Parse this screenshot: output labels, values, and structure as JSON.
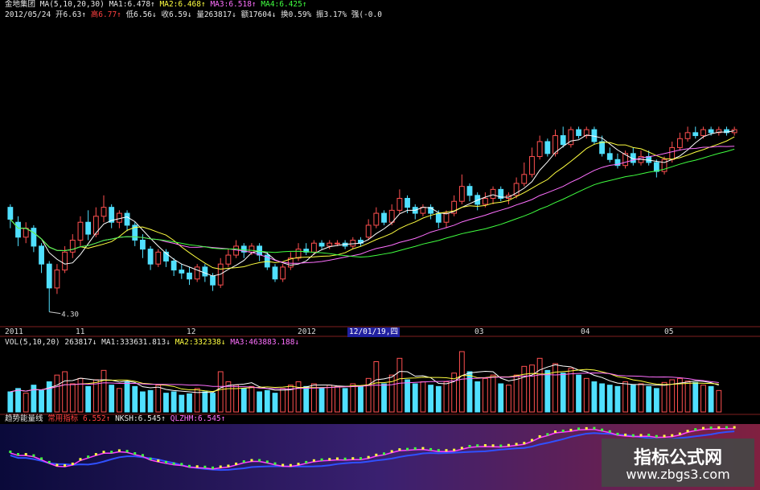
{
  "header": {
    "stock_name": "金地集团",
    "ma_params": "MA(5,10,20,30)",
    "ma1": "MA1:6.478↑",
    "ma2": "MA2:6.468↑",
    "ma3": "MA3:6.518↑",
    "ma4": "MA4:6.425↑",
    "date": "2012/05/24",
    "open": "开6.63↑",
    "high": "高6.77↑",
    "low": "低6.56↓",
    "close": "收6.59↓",
    "volume": "量263817↓",
    "amount": "额17604↓",
    "turnover": "换0.59%",
    "amplitude": "振3.17%",
    "strength": "强(-0.0"
  },
  "vol_header": {
    "params": "VOL(5,10,20)",
    "vol": "263817↓",
    "ma1": "MA1:333631.813↓",
    "ma2": "MA2:332338↓",
    "ma3": "MA3:463883.188↓"
  },
  "ind_header": {
    "name": "趋势能量线",
    "label": "常用指标",
    "value": "6.552↑",
    "nksh": "NKSH:6.545↑",
    "qlzhm": "QLZHM:6.545↑"
  },
  "x_axis": {
    "labels": [
      "2011",
      "11",
      "12",
      "2012",
      "03",
      "04",
      "05"
    ],
    "cursor_date": "12/01/19,四"
  },
  "watermark": {
    "line1": "指标公式网",
    "line2": "www.zbgs3.com"
  },
  "colors": {
    "up": "#ff5050",
    "down": "#50e0ff",
    "ma5": "#ffffff",
    "ma10": "#ffff40",
    "ma20": "#ff70ff",
    "ma30": "#40ff40"
  },
  "chart_data": {
    "type": "candlestick",
    "low_annotation": "4.30",
    "price_range": [
      4.2,
      7.5
    ],
    "candles": [
      [
        6.05,
        5.85,
        6.1,
        5.7
      ],
      [
        5.8,
        5.55,
        5.9,
        5.4
      ],
      [
        5.55,
        5.7,
        5.8,
        5.45
      ],
      [
        5.7,
        5.4,
        5.75,
        5.3
      ],
      [
        5.4,
        5.1,
        5.45,
        4.95
      ],
      [
        5.1,
        4.7,
        5.15,
        4.3
      ],
      [
        4.7,
        5.0,
        5.1,
        4.6
      ],
      [
        5.0,
        5.3,
        5.4,
        4.95
      ],
      [
        5.3,
        5.5,
        5.6,
        5.2
      ],
      [
        5.5,
        5.8,
        5.9,
        5.4
      ],
      [
        5.8,
        5.6,
        6.0,
        5.5
      ],
      [
        5.6,
        5.9,
        6.05,
        5.55
      ],
      [
        5.9,
        6.05,
        6.25,
        5.8
      ],
      [
        6.05,
        5.8,
        6.1,
        5.7
      ],
      [
        5.8,
        5.95,
        6.0,
        5.7
      ],
      [
        5.95,
        5.75,
        6.0,
        5.65
      ],
      [
        5.75,
        5.5,
        5.8,
        5.4
      ],
      [
        5.5,
        5.35,
        5.6,
        5.2
      ],
      [
        5.35,
        5.1,
        5.4,
        5.0
      ],
      [
        5.1,
        5.3,
        5.35,
        5.05
      ],
      [
        5.3,
        5.15,
        5.35,
        5.05
      ],
      [
        5.15,
        5.0,
        5.2,
        4.9
      ],
      [
        5.0,
        4.95,
        5.1,
        4.85
      ],
      [
        4.95,
        4.85,
        5.05,
        4.75
      ],
      [
        4.85,
        5.05,
        5.1,
        4.8
      ],
      [
        5.05,
        4.9,
        5.1,
        4.8
      ],
      [
        4.9,
        4.75,
        4.95,
        4.65
      ],
      [
        4.75,
        5.1,
        5.2,
        4.7
      ],
      [
        5.1,
        5.25,
        5.35,
        5.05
      ],
      [
        5.25,
        5.4,
        5.5,
        5.2
      ],
      [
        5.4,
        5.3,
        5.45,
        5.2
      ],
      [
        5.3,
        5.4,
        5.45,
        5.25
      ],
      [
        5.4,
        5.25,
        5.45,
        5.15
      ],
      [
        5.25,
        5.05,
        5.3,
        5.0
      ],
      [
        5.05,
        4.85,
        5.1,
        4.8
      ],
      [
        4.85,
        5.05,
        5.1,
        4.8
      ],
      [
        5.05,
        5.2,
        5.3,
        5.0
      ],
      [
        5.2,
        5.35,
        5.45,
        5.15
      ],
      [
        5.35,
        5.3,
        5.45,
        5.25
      ],
      [
        5.3,
        5.45,
        5.5,
        5.25
      ],
      [
        5.45,
        5.4,
        5.5,
        5.35
      ],
      [
        5.4,
        5.45,
        5.5,
        5.35
      ],
      [
        5.45,
        5.45,
        5.5,
        5.4
      ],
      [
        5.45,
        5.4,
        5.5,
        5.35
      ],
      [
        5.4,
        5.5,
        5.55,
        5.35
      ],
      [
        5.5,
        5.45,
        5.55,
        5.4
      ],
      [
        5.55,
        5.75,
        5.85,
        5.5
      ],
      [
        5.75,
        5.95,
        6.05,
        5.7
      ],
      [
        5.95,
        5.8,
        6.0,
        5.75
      ],
      [
        5.8,
        6.0,
        6.1,
        5.75
      ],
      [
        6.0,
        6.2,
        6.35,
        5.95
      ],
      [
        6.2,
        6.05,
        6.25,
        5.95
      ],
      [
        6.05,
        5.95,
        6.1,
        5.85
      ],
      [
        5.95,
        6.05,
        6.1,
        5.9
      ],
      [
        6.05,
        5.95,
        6.1,
        5.85
      ],
      [
        5.95,
        5.8,
        6.0,
        5.7
      ],
      [
        5.8,
        5.95,
        6.0,
        5.7
      ],
      [
        5.95,
        6.15,
        6.25,
        5.9
      ],
      [
        6.15,
        6.4,
        6.6,
        6.1
      ],
      [
        6.4,
        6.25,
        6.45,
        6.15
      ],
      [
        6.25,
        6.1,
        6.3,
        6.0
      ],
      [
        6.1,
        6.2,
        6.3,
        6.05
      ],
      [
        6.2,
        6.35,
        6.4,
        6.1
      ],
      [
        6.35,
        6.2,
        6.4,
        6.15
      ],
      [
        6.2,
        6.25,
        6.3,
        6.1
      ],
      [
        6.25,
        6.45,
        6.55,
        6.2
      ],
      [
        6.45,
        6.6,
        6.8,
        6.4
      ],
      [
        6.6,
        6.9,
        7.05,
        6.55
      ],
      [
        6.9,
        7.15,
        7.25,
        6.85
      ],
      [
        7.15,
        6.95,
        7.2,
        6.9
      ],
      [
        6.95,
        7.25,
        7.35,
        6.9
      ],
      [
        7.25,
        7.1,
        7.4,
        7.05
      ],
      [
        7.1,
        7.35,
        7.4,
        7.05
      ],
      [
        7.35,
        7.25,
        7.4,
        7.2
      ],
      [
        7.25,
        7.35,
        7.4,
        7.2
      ],
      [
        7.35,
        7.15,
        7.4,
        7.1
      ],
      [
        7.15,
        6.95,
        7.25,
        6.9
      ],
      [
        6.95,
        6.85,
        7.05,
        6.8
      ],
      [
        6.85,
        6.75,
        6.95,
        6.7
      ],
      [
        6.75,
        6.95,
        7.0,
        6.7
      ],
      [
        6.95,
        6.8,
        7.05,
        6.75
      ],
      [
        6.8,
        6.9,
        7.0,
        6.75
      ],
      [
        6.9,
        6.8,
        7.0,
        6.75
      ],
      [
        6.8,
        6.65,
        6.85,
        6.55
      ],
      [
        6.65,
        6.85,
        6.9,
        6.6
      ],
      [
        6.85,
        7.05,
        7.15,
        6.8
      ],
      [
        7.05,
        7.2,
        7.3,
        7.0
      ],
      [
        7.2,
        7.3,
        7.4,
        7.15
      ],
      [
        7.3,
        7.25,
        7.4,
        7.2
      ],
      [
        7.25,
        7.35,
        7.4,
        7.2
      ],
      [
        7.35,
        7.3,
        7.4,
        7.25
      ],
      [
        7.3,
        7.35,
        7.4,
        7.25
      ],
      [
        7.35,
        7.3,
        7.4,
        7.25
      ],
      [
        7.3,
        7.35,
        7.4,
        7.25
      ]
    ],
    "volume": [
      30,
      35,
      28,
      40,
      32,
      45,
      55,
      60,
      42,
      50,
      38,
      48,
      62,
      40,
      35,
      45,
      38,
      30,
      32,
      40,
      28,
      30,
      25,
      27,
      35,
      30,
      28,
      60,
      45,
      40,
      35,
      38,
      30,
      32,
      28,
      35,
      40,
      45,
      38,
      42,
      36,
      40,
      38,
      35,
      42,
      38,
      50,
      75,
      42,
      55,
      80,
      48,
      42,
      45,
      40,
      38,
      45,
      58,
      90,
      60,
      45,
      50,
      55,
      42,
      40,
      55,
      68,
      70,
      80,
      62,
      72,
      58,
      65,
      55,
      50,
      45,
      42,
      40,
      38,
      45,
      40,
      42,
      38,
      35,
      44,
      48,
      50,
      46,
      44,
      40,
      38,
      32
    ]
  }
}
